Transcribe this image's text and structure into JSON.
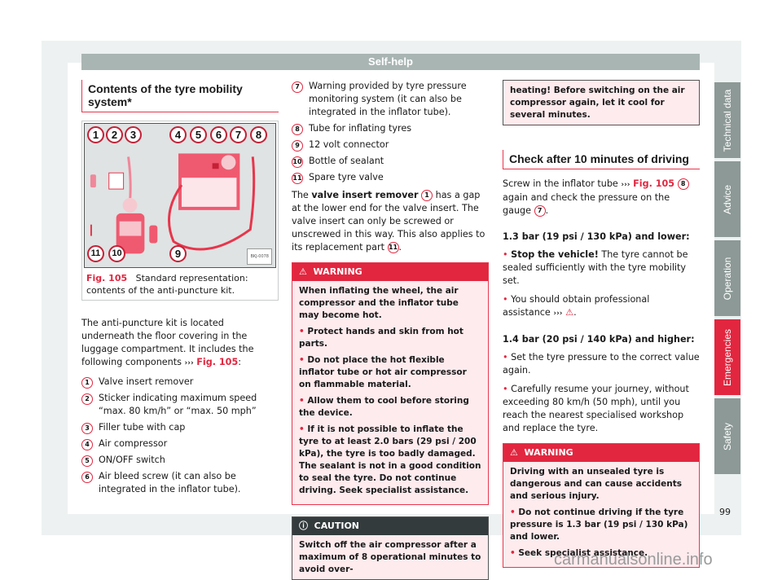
{
  "header": {
    "title": "Self-help"
  },
  "col1": {
    "section_title": "Contents of the tyre mobility system*",
    "figure": {
      "ref": "Fig. 105",
      "caption": "Standard representation: contents of the anti-puncture kit.",
      "image_code": "BKJ-0078",
      "callouts": [
        "1",
        "2",
        "3",
        "4",
        "5",
        "6",
        "7",
        "8",
        "9",
        "10",
        "11"
      ]
    },
    "intro": "The anti-puncture kit is located underneath the floor covering in the luggage compartment. It includes the following components",
    "intro_arrows": "›››",
    "intro_ref": "Fig. 105",
    "intro_end": ":",
    "items": [
      {
        "num": "1",
        "text": "Valve insert remover"
      },
      {
        "num": "2",
        "text": "Sticker indicating maximum speed “max. 80 km/h” or “max. 50 mph”"
      },
      {
        "num": "3",
        "text": "Filler tube with cap"
      },
      {
        "num": "4",
        "text": "Air compressor"
      },
      {
        "num": "5",
        "text": "ON/OFF switch"
      },
      {
        "num": "6",
        "text": "Air bleed screw (it can also be integrated in the inflator tube)."
      }
    ]
  },
  "col2": {
    "items": [
      {
        "num": "7",
        "text": "Warning provided by tyre pressure monitoring system (it can also be integrated in the inflator tube)."
      },
      {
        "num": "8",
        "text": "Tube for inflating tyres"
      },
      {
        "num": "9",
        "text": "12 volt connector"
      },
      {
        "num": "10",
        "text": "Bottle of sealant"
      },
      {
        "num": "11",
        "text": "Spare tyre valve"
      }
    ],
    "para_prefix": "The",
    "para_bold": "valve insert remover",
    "para_num1": "1",
    "para_rest": "has a gap at the lower end for the valve insert. The valve insert can only be screwed or unscrewed in this way. This also applies to its replacement part",
    "para_num2": "11",
    "warning": {
      "title": "WARNING",
      "intro": "When inflating the wheel, the air compressor and the inflator tube may become hot.",
      "bullets": [
        "Protect hands and skin from hot parts.",
        "Do not place the hot flexible inflator tube or hot air compressor on flammable material.",
        "Allow them to cool before storing the device.",
        "If it is not possible to inflate the tyre to at least 2.0 bars (29 psi / 200 kPa), the tyre is too badly damaged. The sealant is not in a good condition to seal the tyre. Do not continue driving. Seek specialist assistance."
      ]
    },
    "caution": {
      "title": "CAUTION",
      "text": "Switch off the air compressor after a maximum of 8 operational minutes to avoid over-"
    }
  },
  "col3": {
    "caution_cont": "heating! Before switching on the air compressor again, let it cool for several minutes.",
    "section_title": "Check after 10 minutes of driving",
    "para_a": "Screw in the inflator tube",
    "para_arrows": "›››",
    "para_ref": "Fig. 105",
    "para_num1": "8",
    "para_b": "again and check the pressure on the gauge",
    "para_num2": "7",
    "low": {
      "heading": "1.3 bar (19 psi / 130 kPa) and lower:",
      "b1_bold": "Stop the vehicle!",
      "b1_text": "The tyre cannot be sealed sufficiently with the tyre mobility set.",
      "b2_text": "You should obtain professional assistance",
      "b2_arrows": "›››"
    },
    "high": {
      "heading": "1.4 bar (20 psi / 140 kPa) and higher:",
      "bullets": [
        "Set the tyre pressure to the correct value again.",
        "Carefully resume your journey, without exceeding 80 km/h (50 mph), until you reach the nearest specialised workshop and replace the tyre."
      ]
    },
    "warning": {
      "title": "WARNING",
      "intro": "Driving with an unsealed tyre is dangerous and can cause accidents and serious injury.",
      "bullets": [
        "Do not continue driving if the tyre pressure is 1.3 bar (19 psi / 130 kPa) and lower.",
        "Seek specialist assistance."
      ]
    }
  },
  "side_tabs": [
    {
      "label": "Technical data",
      "active": false
    },
    {
      "label": "Advice",
      "active": false
    },
    {
      "label": "Operation",
      "active": false
    },
    {
      "label": "Emergencies",
      "active": true
    },
    {
      "label": "Safety",
      "active": false
    }
  ],
  "page_number": "99",
  "watermark": "carmanualsonline.info",
  "colors": {
    "accent_red": "#e2263f",
    "tab_gray": "#8c9996",
    "header_gray": "#a9b5b3",
    "caution_dark": "#343b3c"
  }
}
